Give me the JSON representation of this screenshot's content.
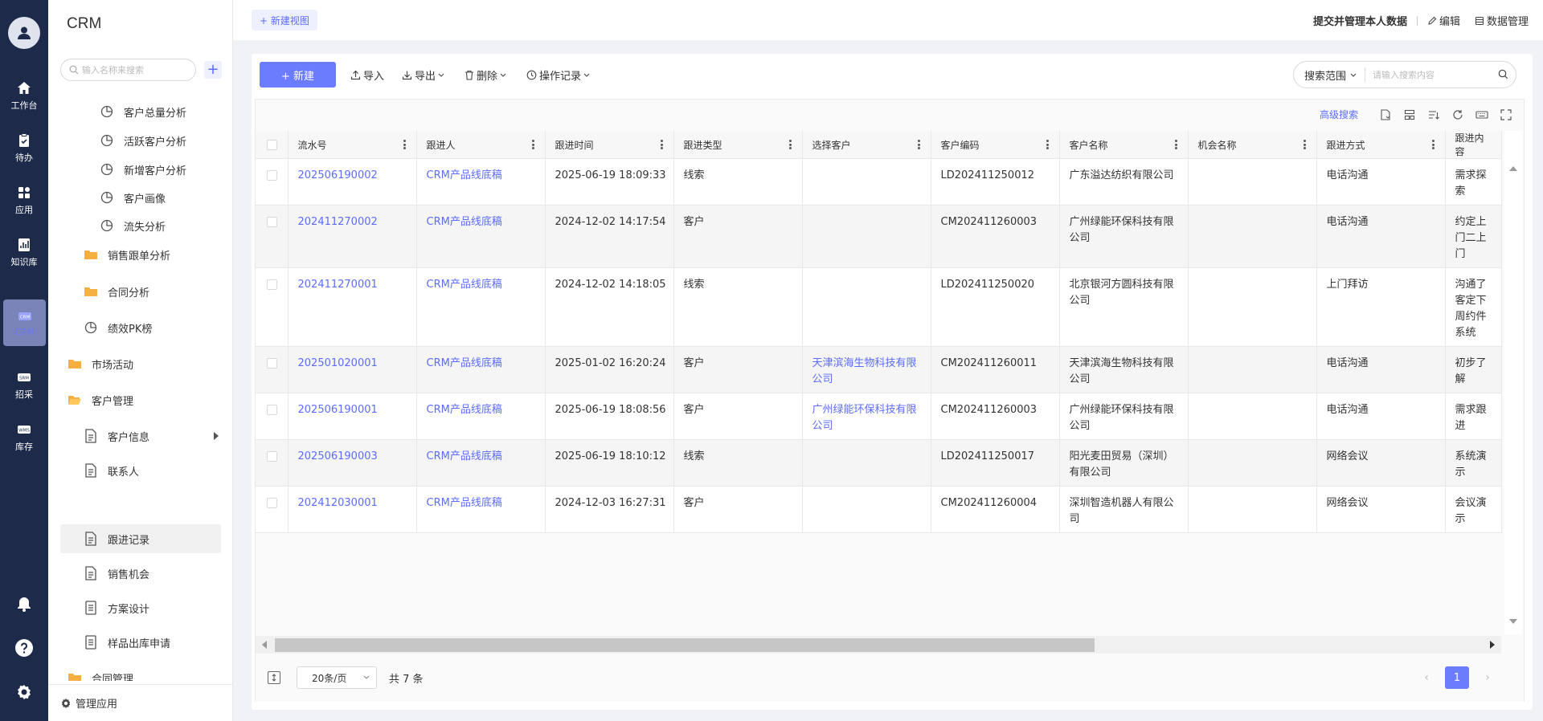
{
  "rail": {
    "items": [
      {
        "label": "工作台",
        "icon": "home-icon"
      },
      {
        "label": "待办",
        "icon": "clipboard-icon"
      },
      {
        "label": "应用",
        "icon": "apps-icon"
      },
      {
        "label": "知识库",
        "icon": "chart-book-icon"
      },
      {
        "label": "CRM",
        "icon": "crm-icon",
        "badge": "CRM"
      },
      {
        "label": "招采",
        "icon": "srm-icon",
        "badge": "SRM"
      },
      {
        "label": "库存",
        "icon": "wms-icon",
        "badge": "WMS"
      }
    ]
  },
  "sidebar": {
    "app_title": "CRM",
    "search_placeholder": "输入名称来搜索",
    "add_label": "+",
    "items": [
      {
        "label": "客户总量分析",
        "icon": "pie-chart-icon",
        "level": 3
      },
      {
        "label": "活跃客户分析",
        "icon": "pie-chart-icon",
        "level": 3
      },
      {
        "label": "新增客户分析",
        "icon": "pie-chart-icon",
        "level": 3
      },
      {
        "label": "客户画像",
        "icon": "pie-chart-icon",
        "level": 3
      },
      {
        "label": "流失分析",
        "icon": "pie-chart-icon",
        "level": 3
      },
      {
        "label": "销售跟单分析",
        "icon": "folder-icon",
        "level": 2
      },
      {
        "label": "合同分析",
        "icon": "folder-icon",
        "level": 2
      },
      {
        "label": "绩效PK榜",
        "icon": "pie-chart-icon",
        "level": 2
      },
      {
        "label": "市场活动",
        "icon": "folder-icon",
        "level": 1
      },
      {
        "label": "客户管理",
        "icon": "folder-open-icon",
        "level": 1
      },
      {
        "label": "客户信息",
        "icon": "document-icon",
        "level": 2,
        "has_children": true
      },
      {
        "label": "联系人",
        "icon": "document-icon",
        "level": 2
      },
      {
        "label": "跟进记录",
        "icon": "document-icon",
        "level": 2,
        "selected": true
      },
      {
        "label": "销售机会",
        "icon": "document-icon",
        "level": 2
      },
      {
        "label": "方案设计",
        "icon": "form-icon",
        "level": 2
      },
      {
        "label": "样品出库申请",
        "icon": "form-icon",
        "level": 2
      },
      {
        "label": "合同管理",
        "icon": "folder-icon",
        "level": 1
      }
    ],
    "manage_label": "管理应用"
  },
  "topbar": {
    "new_view_label": "+ 新建视图",
    "submit_label": "提交并管理本人数据",
    "edit_label": "编辑",
    "data_manage_label": "数据管理"
  },
  "toolbar": {
    "new_label": "+ 新建",
    "import_label": "导入",
    "export_label": "导出",
    "delete_label": "删除",
    "log_label": "操作记录",
    "search_scope": "搜索范围",
    "search_placeholder": "请输入搜索内容"
  },
  "grid": {
    "advanced_search": "高级搜索",
    "columns": [
      "流水号",
      "跟进人",
      "跟进时间",
      "跟进类型",
      "选择客户",
      "客户编码",
      "客户名称",
      "机会名称",
      "跟进方式",
      "跟进内容"
    ],
    "rows": [
      [
        "202506190002",
        "CRM产品线底稿",
        "2025-06-19 18:09:33",
        "线索",
        "",
        "LD202411250012",
        "广东溢达纺织有限公司",
        "",
        "电话沟通",
        "需求探索"
      ],
      [
        "202411270002",
        "CRM产品线底稿",
        "2024-12-02 14:17:54",
        "客户",
        "",
        "CM202411260003",
        "广州绿能环保科技有限公司",
        "",
        "电话沟通",
        "约定上门二上门"
      ],
      [
        "202411270001",
        "CRM产品线底稿",
        "2024-12-02 14:18:05",
        "线索",
        "",
        "LD202411250020",
        "北京银河方圆科技有限公司",
        "",
        "上门拜访",
        "沟通了客定下周约件系统"
      ],
      [
        "202501020001",
        "CRM产品线底稿",
        "2025-01-02 16:20:24",
        "客户",
        "天津滨海生物科技有限公司",
        "CM202411260011",
        "天津滨海生物科技有限公司",
        "",
        "电话沟通",
        "初步了解"
      ],
      [
        "202506190001",
        "CRM产品线底稿",
        "2025-06-19 18:08:56",
        "客户",
        "广州绿能环保科技有限公司",
        "CM202411260003",
        "广州绿能环保科技有限公司",
        "",
        "电话沟通",
        "需求跟进"
      ],
      [
        "202506190003",
        "CRM产品线底稿",
        "2025-06-19 18:10:12",
        "线索",
        "",
        "LD202411250017",
        "阳光麦田贸易（深圳）有限公司",
        "",
        "网络会议",
        "系统演示"
      ],
      [
        "202412030001",
        "CRM产品线底稿",
        "2024-12-03 16:27:31",
        "客户",
        "",
        "CM202411260004",
        "深圳智造机器人有限公司",
        "",
        "网络会议",
        "会议演示"
      ]
    ]
  },
  "pager": {
    "page_size": "20条/页",
    "total": "共 7 条",
    "current_page": "1"
  },
  "colors": {
    "rail_bg": "#1e2a4a",
    "accent": "#6c7cff",
    "link": "#5b6cff"
  }
}
